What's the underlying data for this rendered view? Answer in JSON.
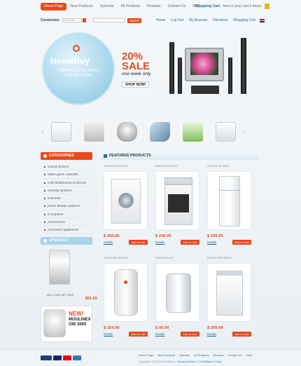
{
  "nav": {
    "items": [
      "Home Page",
      "New Products",
      "Specials",
      "All Products",
      "Reviews",
      "Contact Us",
      "FAQ"
    ],
    "cart_label": "Shopping Cart:",
    "cart_status": "now in your cart 0 items"
  },
  "bar2": {
    "currencies_label": "Currencies:",
    "currency_value": "US Dollar",
    "search_button": "Search",
    "links": [
      "Home",
      "Log Out",
      "My Account",
      "Checkout",
      "Shopping Cart"
    ]
  },
  "banner": {
    "brand": "HomeBuy",
    "subtitle": "HOME ELECTRONICS ONLINE SHOP",
    "sale_percent": "20%",
    "sale_word": "SALE",
    "sale_sub": "one week only",
    "shop_button": "SHOP NOW!"
  },
  "sidebar": {
    "categories_title": "CATEGORIES",
    "categories": [
      "Sound devices",
      "Video game consoles",
      "Cell headphones & phones",
      "Security systems",
      "Cameras",
      "Home theater systems",
      "Computers",
      "Accessories",
      "Consumer appliances"
    ],
    "specials_title": "SPECIALS",
    "special_name": "JAN COMFORT 500R",
    "special_price": "$51.00",
    "new_tag": "NEW!",
    "new_name_1": "MOULINEX",
    "new_name_2": "OW 3000"
  },
  "featured": {
    "title": "FEATURED PRODUCTS",
    "details_label": "Details",
    "add_label": "Add to Cart",
    "products": [
      {
        "name": "SAMSUNG WF0400",
        "price": "$ 200.00"
      },
      {
        "name": "INDESIT KN3G217",
        "price": "$ 249.95"
      },
      {
        "name": "INDESIT SE 1045",
        "price": "$ 199.95"
      },
      {
        "name": "GORENJE GBF8012",
        "price": "$ 154.95"
      },
      {
        "name": "ROWENTA HU",
        "price": "$ 90.00"
      },
      {
        "name": "BOSCH SGS 46E12",
        "price": "$ 299.99"
      }
    ]
  },
  "footer": {
    "links": [
      "Home Page",
      "New Products",
      "Specials",
      "All Products",
      "Reviews",
      "Contact Us",
      "FAQ"
    ],
    "copyright": "Copyright © 2010 HomeBuy",
    "privacy": "Privacy Notice",
    "conditions": "Conditions of Use"
  },
  "colors": {
    "accent": "#e8491d",
    "link": "#1a6aa0",
    "banner_circle": "#9fd2ea"
  }
}
